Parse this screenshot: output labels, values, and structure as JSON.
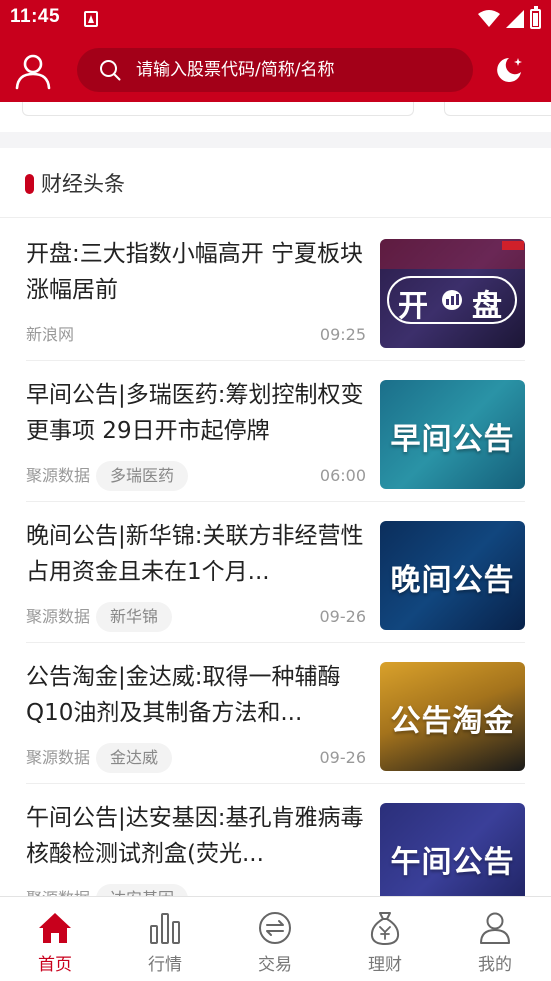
{
  "status_bar": {
    "time": "11:45",
    "icons": [
      "notification-icon",
      "wifi-icon",
      "signal-icon",
      "battery-icon"
    ]
  },
  "header": {
    "search": {
      "placeholder": "请输入股票代码/简称/名称"
    },
    "icons": [
      "user-icon",
      "search-icon",
      "night-mode-icon"
    ]
  },
  "section": {
    "title": "财经头条"
  },
  "news": [
    {
      "title": "开盘:三大指数小幅高开 宁夏板块涨幅居前",
      "source": "新浪网",
      "tag": "",
      "time": "09:25",
      "thumb_label": "开盘"
    },
    {
      "title": "早间公告|多瑞医药:筹划控制权变更事项 29日开市起停牌",
      "source": "聚源数据",
      "tag": "多瑞医药",
      "time": "06:00",
      "thumb_label": "早间公告"
    },
    {
      "title": "晚间公告|新华锦:关联方非经营性占用资金且未在1个月...",
      "source": "聚源数据",
      "tag": "新华锦",
      "time": "09-26",
      "thumb_label": "晚间公告"
    },
    {
      "title": "公告淘金|金达威:取得一种辅酶Q10油剂及其制备方法和...",
      "source": "聚源数据",
      "tag": "金达威",
      "time": "09-26",
      "thumb_label": "公告淘金"
    },
    {
      "title": "午间公告|达安基因:基孔肯雅病毒核酸检测试剂盒(荧光...",
      "source": "聚源数据",
      "tag": "达安基因",
      "time": "",
      "thumb_label": "午间公告"
    }
  ],
  "bottom_nav": [
    {
      "label": "首页",
      "icon": "home-icon",
      "active": true
    },
    {
      "label": "行情",
      "icon": "market-chart-icon",
      "active": false
    },
    {
      "label": "交易",
      "icon": "trade-exchange-icon",
      "active": false
    },
    {
      "label": "理财",
      "icon": "money-bag-icon",
      "active": false
    },
    {
      "label": "我的",
      "icon": "profile-icon",
      "active": false
    }
  ],
  "colors": {
    "brand_red": "#c8001c",
    "search_bg": "#a30018"
  }
}
